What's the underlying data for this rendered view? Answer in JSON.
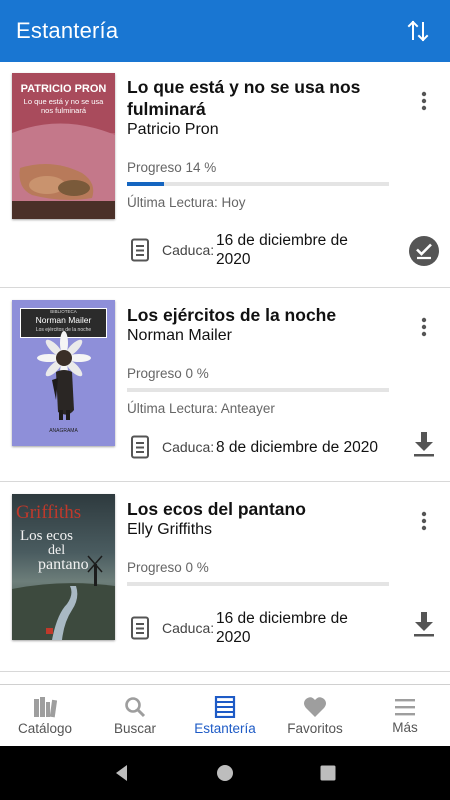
{
  "appbar": {
    "title": "Estantería",
    "sort_icon": "sort-arrows-icon"
  },
  "books": [
    {
      "cover_author": "PATRICIO PRON",
      "cover_title": "Lo que está y no se usa nos fulminará",
      "title": "Lo que está y no se usa nos fulminará",
      "author": "Patricio Pron",
      "progress_label": "Progreso 14 %",
      "progress": 0.14,
      "last_read": "Última Lectura: Hoy",
      "expiry_label": "Caduca:",
      "expiry_date": "16 de diciembre de 2020",
      "action_icon": "check-circle-icon"
    },
    {
      "cover_series": "BIBLIOTECA",
      "cover_author": "Norman Mailer",
      "cover_title": "Los ejércitos de la noche",
      "cover_publisher": "ANAGRAMA",
      "title": "Los ejércitos de la noche",
      "author": "Norman Mailer",
      "progress_label": "Progreso 0 %",
      "progress": 0,
      "last_read": "Última Lectura: Anteayer",
      "expiry_label": "Caduca:",
      "expiry_date": "8 de diciembre de 2020",
      "action_icon": "download-icon"
    },
    {
      "cover_author": "Griffiths",
      "cover_title_1": "Los ecos",
      "cover_title_2": "del",
      "cover_title_3": "pantano",
      "title": "Los ecos del pantano",
      "author": "Elly Griffiths",
      "progress_label": "Progreso 0 %",
      "progress": 0,
      "expiry_label": "Caduca:",
      "expiry_date": "16 de diciembre de 2020",
      "action_icon": "download-icon"
    }
  ],
  "bottom_nav": [
    {
      "label": "Catálogo",
      "icon": "books-icon",
      "active": false
    },
    {
      "label": "Buscar",
      "icon": "search-icon",
      "active": false
    },
    {
      "label": "Estantería",
      "icon": "shelf-icon",
      "active": true
    },
    {
      "label": "Favoritos",
      "icon": "heart-icon",
      "active": false
    },
    {
      "label": "Más",
      "icon": "menu-icon",
      "active": false
    }
  ],
  "colors": {
    "primary": "#1976d2",
    "progress": "#1565c0",
    "active_nav": "#1e5bc6"
  }
}
